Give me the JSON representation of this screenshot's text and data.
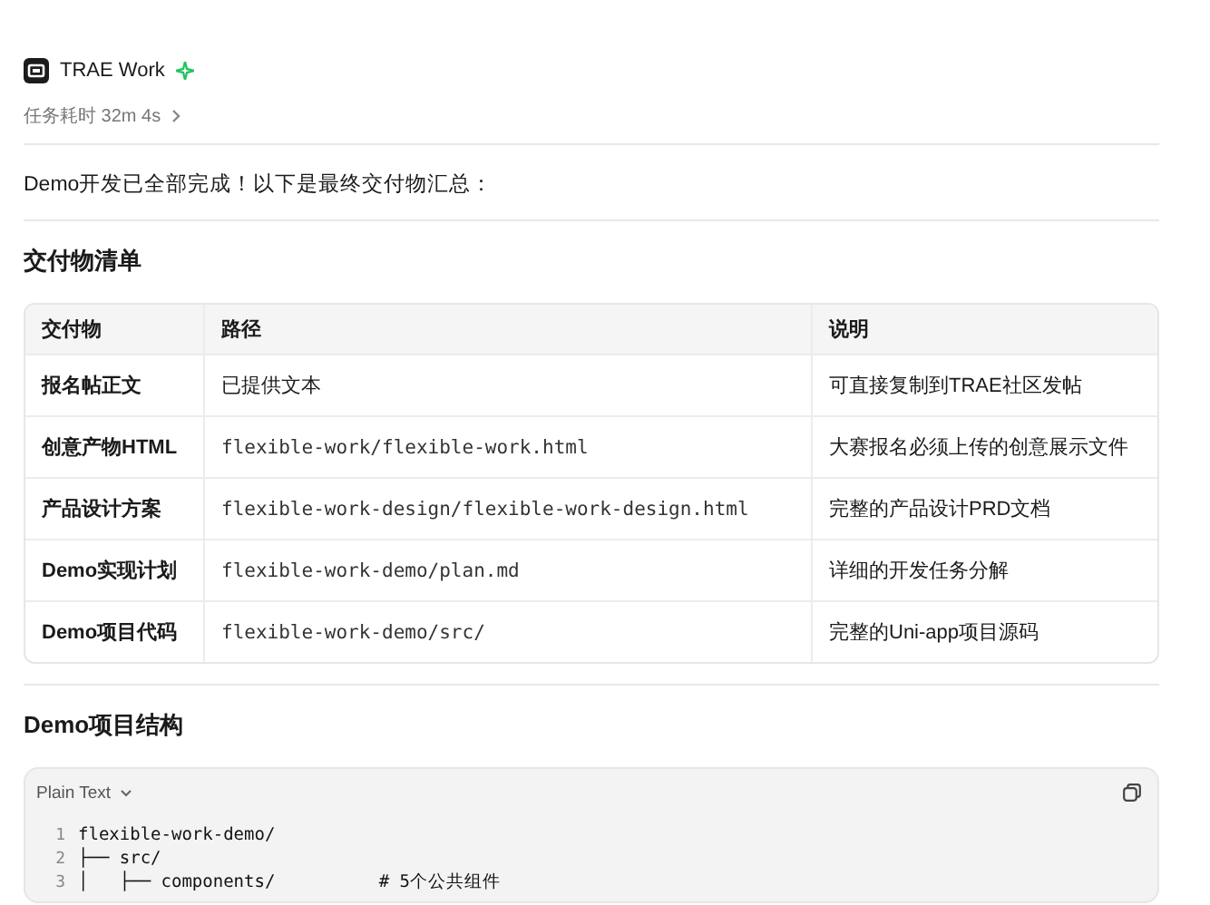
{
  "header": {
    "app_name": "TRAE Work",
    "duration": "任务耗时 32m 4s"
  },
  "intro": "Demo开发已全部完成！以下是最终交付物汇总：",
  "deliverables": {
    "heading": "交付物清单",
    "columns": [
      "交付物",
      "路径",
      "说明"
    ],
    "rows": [
      {
        "name": "报名帖正文",
        "path": "已提供文本",
        "kind": "text",
        "note": "可直接复制到TRAE社区发帖"
      },
      {
        "name": "创意产物HTML",
        "path": "flexible-work/flexible-work.html",
        "kind": "code",
        "note": "大赛报名必须上传的创意展示文件"
      },
      {
        "name": "产品设计方案",
        "path": "flexible-work-design/flexible-work-design.html",
        "kind": "code",
        "note": "完整的产品设计PRD文档"
      },
      {
        "name": "Demo实现计划",
        "path": "flexible-work-demo/plan.md",
        "kind": "code",
        "note": "详细的开发任务分解"
      },
      {
        "name": "Demo项目代码",
        "path": "flexible-work-demo/src/",
        "kind": "code",
        "note": "完整的Uni-app项目源码"
      }
    ]
  },
  "structure": {
    "heading": "Demo项目结构",
    "code_block": {
      "language": "Plain Text",
      "lines": [
        {
          "number": "1",
          "text": "flexible-work-demo/"
        },
        {
          "number": "2",
          "text": "├── src/"
        },
        {
          "number": "3",
          "text": "│   ├── components/          # 5个公共组件"
        }
      ]
    }
  }
}
